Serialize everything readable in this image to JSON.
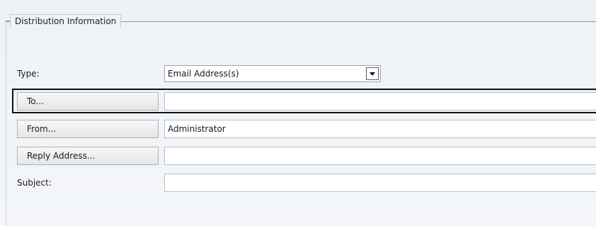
{
  "section": {
    "legend": "Distribution Information"
  },
  "form": {
    "type_label": "Type:",
    "type_value": "Email Address(s)",
    "to_button": "To...",
    "to_value": "",
    "from_button": "From...",
    "from_value": "Administrator",
    "reply_button": "Reply Address...",
    "reply_value": "",
    "subject_label": "Subject:",
    "subject_value": ""
  },
  "icons": {
    "dropdown": "chevron-down-icon"
  }
}
